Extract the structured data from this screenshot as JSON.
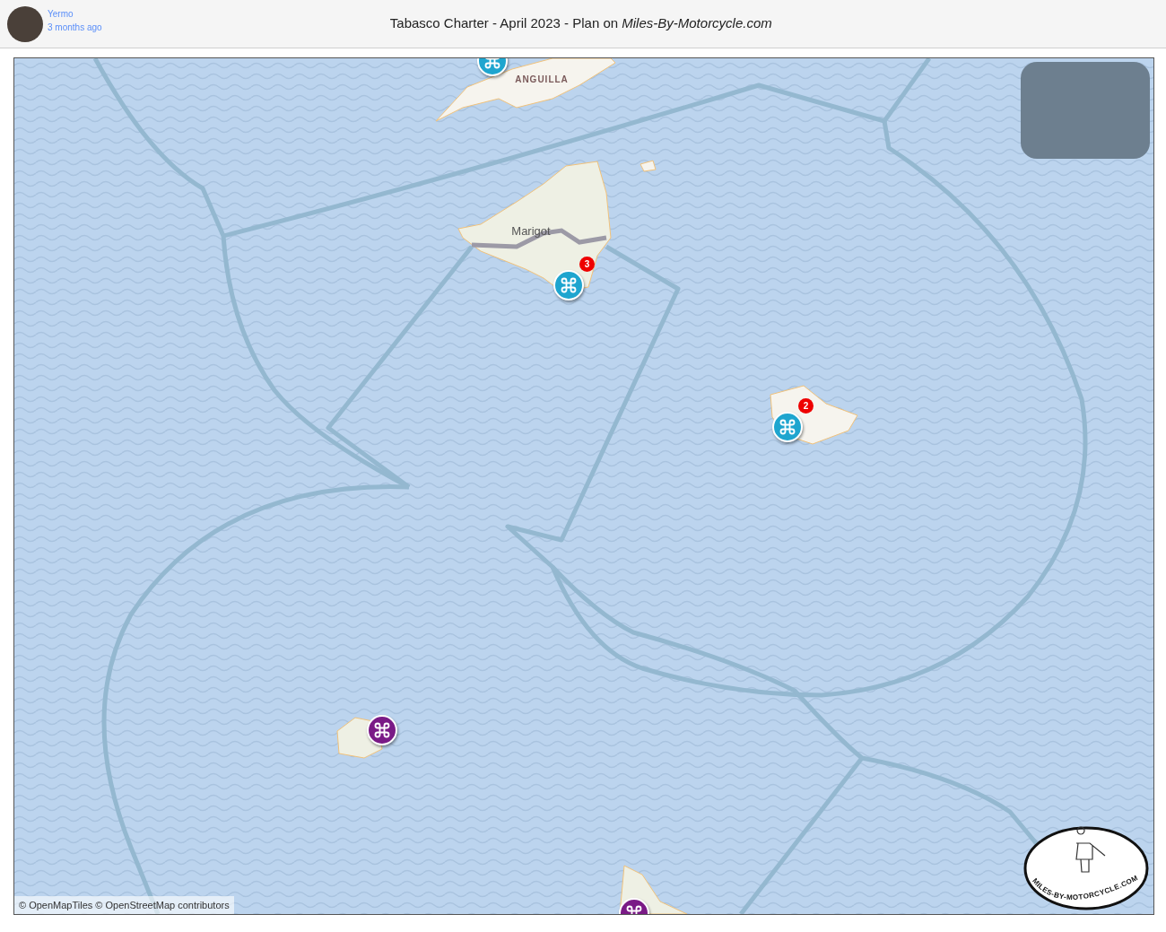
{
  "header": {
    "author": "Yermo",
    "time": "3 months ago",
    "title": "Tabasco Charter - April 2023 - Plan on *Miles-By-Motorcycle.com*"
  },
  "map": {
    "place_labels": [
      {
        "kind": "region",
        "text": "ANGUILLA"
      },
      {
        "kind": "town",
        "text": "Marigot"
      }
    ],
    "markers": [
      {
        "color": "#1ea5cf"
      },
      {
        "color": "#1ea5cf",
        "badge": "3"
      },
      {
        "color": "#1ea5cf",
        "badge": "2"
      },
      {
        "color": "#7a1a86"
      },
      {
        "color": "#7a1a86"
      }
    ],
    "logo_text": "MILES-BY-MOTORCYCLE.COM",
    "attribution": "© OpenMapTiles © OpenStreetMap contributors"
  }
}
